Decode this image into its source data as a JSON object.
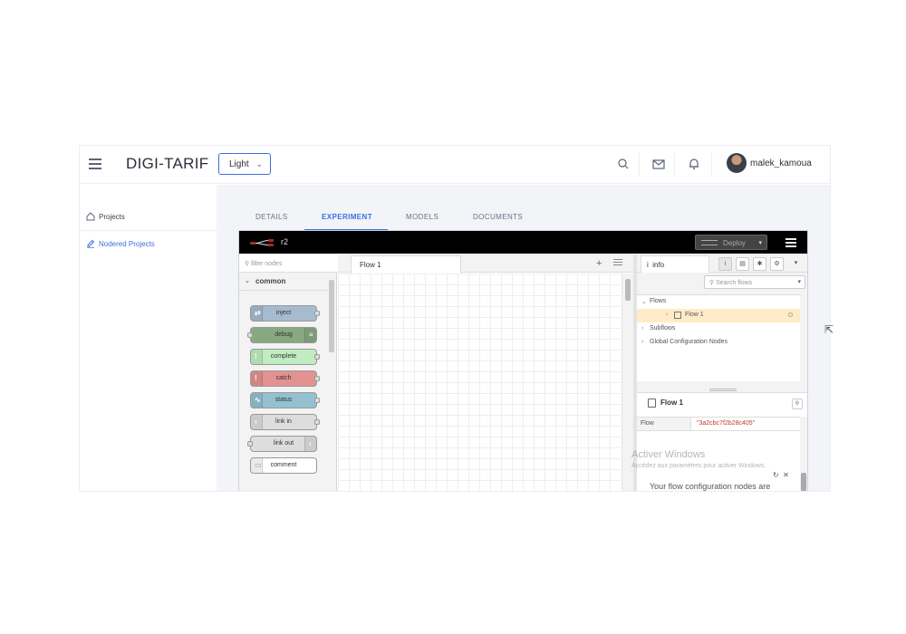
{
  "app": {
    "brand": "DIGI-TARIF",
    "theme_value": "Light",
    "username": "malek_kamoua"
  },
  "sidebar": {
    "items": [
      {
        "label": "Projects"
      },
      {
        "label": "Nodered Projects"
      }
    ]
  },
  "tabs": [
    {
      "label": "DETAILS"
    },
    {
      "label": "EXPERIMENT"
    },
    {
      "label": "MODELS"
    },
    {
      "label": "DOCUMENTS"
    }
  ],
  "nodered": {
    "title": "r2",
    "deploy_label": "Deploy",
    "palette": {
      "filter_placeholder": "filter nodes",
      "category": "common",
      "nodes": [
        {
          "label": "inject",
          "color": "#a6bbcf"
        },
        {
          "label": "debug",
          "color": "#87a980"
        },
        {
          "label": "complete",
          "color": "#c0edc0"
        },
        {
          "label": "catch",
          "color": "#e49191"
        },
        {
          "label": "status",
          "color": "#94c1d0"
        },
        {
          "label": "link in",
          "color": "#dddddd"
        },
        {
          "label": "link out",
          "color": "#dddddd"
        },
        {
          "label": "comment",
          "color": "#ffffff"
        }
      ]
    },
    "workspace": {
      "tab_label": "Flow 1"
    },
    "info": {
      "tab_label": "info",
      "search_placeholder": "Search flows",
      "tree": {
        "flows": "Flows",
        "flow1": "Flow 1",
        "subflows": "Subflows",
        "global": "Global Configuration Nodes"
      },
      "props": {
        "title": "Flow 1",
        "key": "Flow",
        "value": "\"3a2cbc7f2b28c405\""
      },
      "watermark_title": "Activer Windows",
      "watermark_sub": "Accédez aux paramètres pour activer Windows.",
      "config_text": "Your flow configuration nodes are"
    }
  }
}
